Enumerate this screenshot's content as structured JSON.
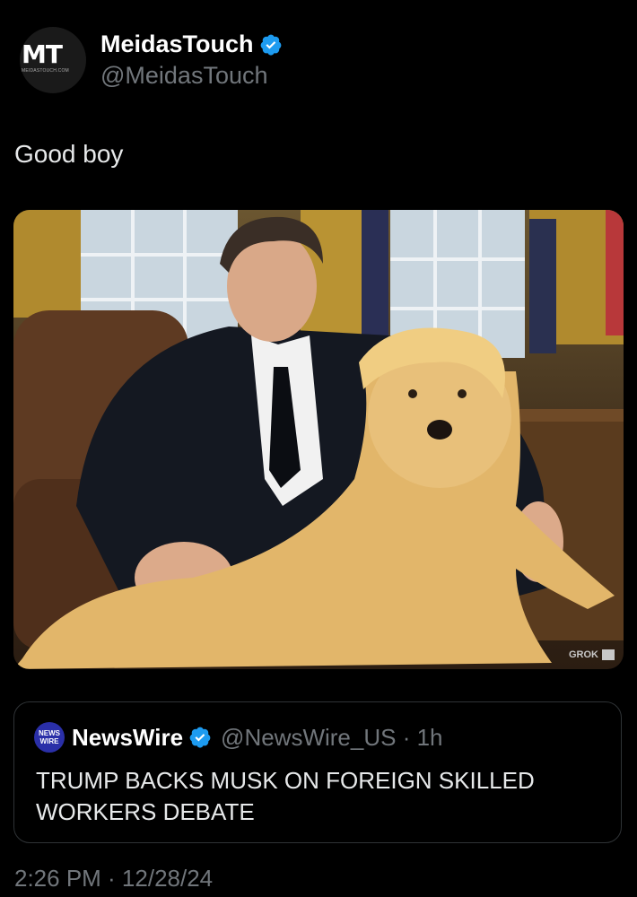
{
  "author": {
    "display_name": "MeidasTouch",
    "handle": "@MeidasTouch",
    "avatar_text": "MT",
    "avatar_subtext": "MEIDASTOUCH.COM",
    "verified_icon": "verified-badge-icon"
  },
  "tweet": {
    "text": "Good boy",
    "media_watermark": "GROK"
  },
  "quoted_tweet": {
    "avatar_text_line1": "NEWS",
    "avatar_text_line2": "WIRE",
    "display_name": "NewsWire",
    "meta": "@NewsWire_US · 1h",
    "text": "TRUMP BACKS MUSK ON FOREIGN SKILLED WORKERS DEBATE"
  },
  "timestamp": "2:26 PM · 12/28/24",
  "colors": {
    "background": "#000000",
    "verified_blue": "#1d9bf0",
    "secondary_text": "#71767b",
    "border": "#2f3336"
  }
}
